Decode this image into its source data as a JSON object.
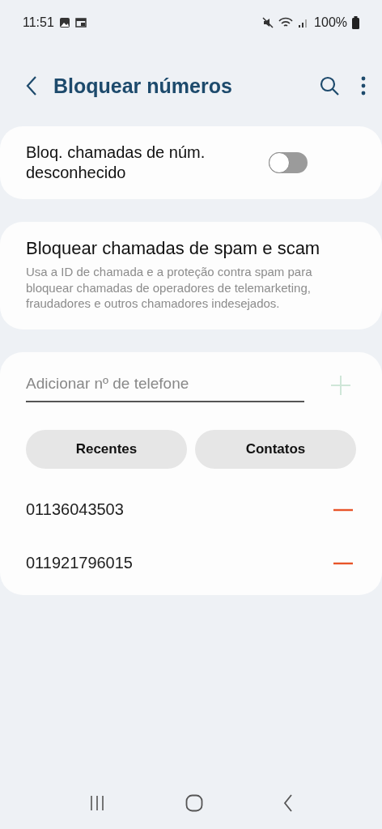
{
  "status_bar": {
    "time": "11:51",
    "battery": "100%"
  },
  "header": {
    "title": "Bloquear números"
  },
  "unknown_toggle": {
    "label": "Bloq. chamadas de núm. desconhecido",
    "on": false
  },
  "spam_card": {
    "title": "Bloquear chamadas de spam e scam",
    "description": "Usa a ID de chamada e a proteção contra spam para bloquear chamadas de operadores de telemarketing, fraudadores e outros chamadores indesejados."
  },
  "add_number": {
    "placeholder": "Adicionar nº de telefone",
    "add_disabled": true
  },
  "buttons": [
    "Recentes",
    "Contatos"
  ],
  "blocked_numbers": [
    {
      "number": "01136043503"
    },
    {
      "number": "011921796015"
    }
  ]
}
